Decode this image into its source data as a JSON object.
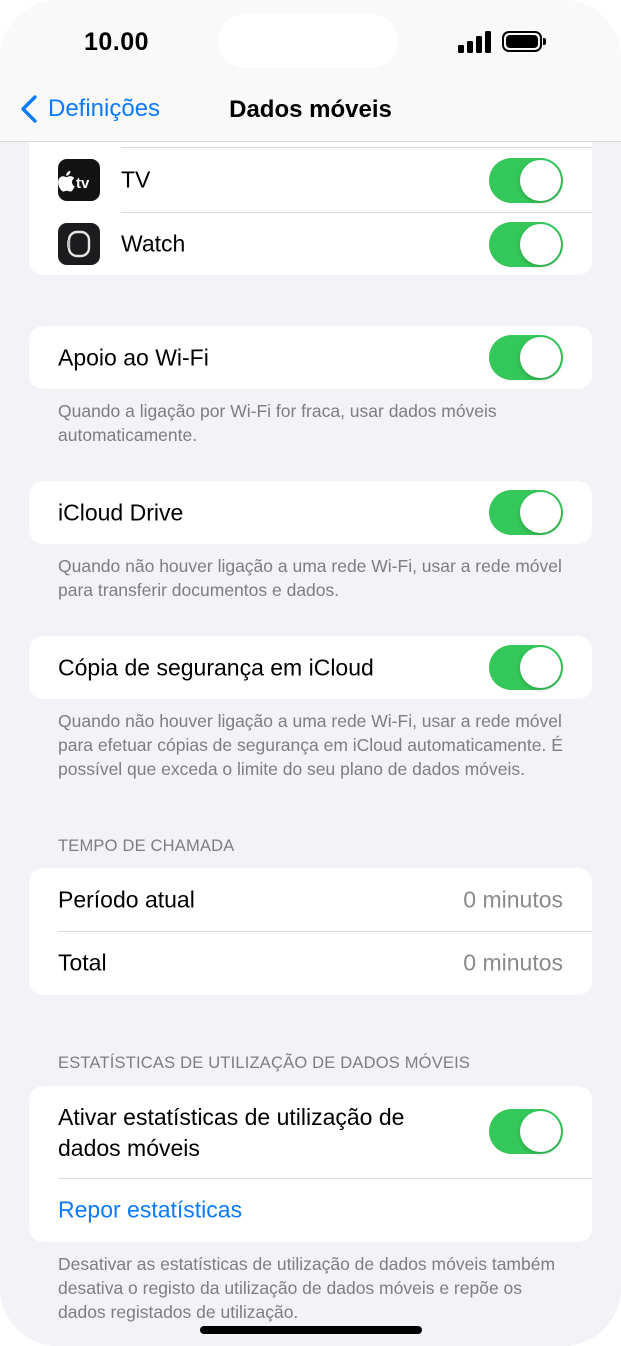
{
  "status": {
    "time": "10.00"
  },
  "nav": {
    "back_label": "Definições",
    "title": "Dados móveis"
  },
  "apps": [
    {
      "name": "TV",
      "icon_text": "tv",
      "enabled": true
    },
    {
      "name": "Watch",
      "enabled": true
    }
  ],
  "wifi_assist": {
    "label": "Apoio ao Wi-Fi",
    "enabled": true,
    "footer": "Quando a ligação por Wi-Fi for fraca, usar dados móveis automaticamente."
  },
  "icloud_drive": {
    "label": "iCloud Drive",
    "enabled": true,
    "footer": "Quando não houver ligação a uma rede Wi-Fi, usar a rede móvel para transferir documentos e dados."
  },
  "icloud_backup": {
    "label": "Cópia de segurança em iCloud",
    "enabled": true,
    "footer": "Quando não houver ligação a uma rede Wi-Fi, usar a rede móvel para efetuar cópias de segurança em iCloud automaticamente. É possível que exceda o limite do seu plano de dados móveis."
  },
  "call_time": {
    "header": "TEMPO DE CHAMADA",
    "rows": [
      {
        "label": "Período atual",
        "value": "0 minutos"
      },
      {
        "label": "Total",
        "value": "0 minutos"
      }
    ]
  },
  "usage_stats": {
    "header": "ESTATÍSTICAS DE UTILIZAÇÃO DE DADOS MÓVEIS",
    "toggle_label": "Ativar estatísticas de utilização de dados móveis",
    "enabled": true,
    "reset_label": "Repor estatísticas",
    "footer": "Desativar as estatísticas de utilização de dados móveis também desativa o registo da utilização de dados móveis e repõe os dados registados de utilização."
  },
  "colors": {
    "accent": "#0a7aff",
    "toggle_on": "#34c759",
    "background": "#f2f2f7"
  }
}
